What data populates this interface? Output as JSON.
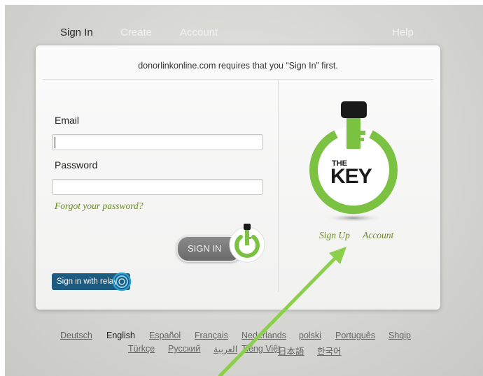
{
  "nav": {
    "sign_in": "Sign In",
    "create": "Create",
    "account": "Account",
    "help": "Help"
  },
  "card": {
    "requires_text": "donorlinkonline.com requires that you “Sign In” first.",
    "email_label": "Email",
    "email_value": "",
    "password_label": "Password",
    "password_value": "",
    "forgot_password": "Forgot your password?",
    "sign_in_button": "SIGN IN",
    "relay_button": "Sign in with relay",
    "logo_text_small": "THE",
    "logo_text_big": "KEY",
    "sign_up_link": "Sign Up",
    "account_link": "Account"
  },
  "languages": {
    "current": "English",
    "row1": [
      "Deutsch",
      "English",
      "Español",
      "Français",
      "Nederlands",
      "polski",
      "Português",
      "Shqip"
    ],
    "row2": [
      "Türkçe",
      "Русский",
      "العربية",
      "Tiếng Việt",
      "日本語",
      "한국어"
    ]
  },
  "colors": {
    "accent_green": "#6b8a2a",
    "key_green": "#7cc242",
    "relay_blue": "#1d5c80",
    "arrow_green": "#8ccf4a"
  }
}
